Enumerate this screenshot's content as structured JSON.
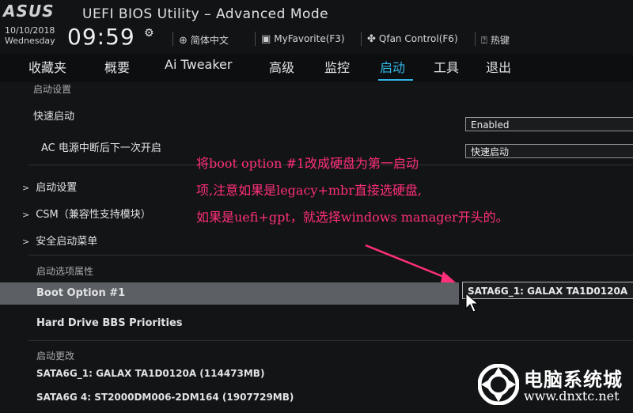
{
  "header": {
    "logo": "ASUS",
    "title": "UEFI BIOS Utility – Advanced Mode",
    "date": "10/10/2018",
    "weekday": "Wednesday",
    "time": "09:59",
    "items": [
      {
        "label": "简体中文",
        "icon": "globe-icon"
      },
      {
        "label": "MyFavorite(F3)",
        "icon": "favorite-icon"
      },
      {
        "label": "Qfan Control(F6)",
        "icon": "fan-icon"
      },
      {
        "label": "热键",
        "icon": "help-icon"
      }
    ]
  },
  "nav": {
    "tabs": [
      "收藏夹",
      "概要",
      "Ai Tweaker",
      "高级",
      "监控",
      "启动",
      "工具",
      "退出"
    ],
    "active": "启动"
  },
  "main": {
    "breadcrumb": "启动设置",
    "fast_boot": "快速启动",
    "ac_power": "AC 电源中断后下一次开启",
    "fast_boot_value": "Enabled",
    "ac_power_value": "快速启动",
    "submenus": [
      "启动设置",
      "CSM（兼容性支持模块）",
      "安全启动菜单"
    ],
    "boot_section": "启动选项属性",
    "boot_option_label": "Boot Option #1",
    "boot_option_value": "SATA6G_1: GALAX TA1D0120A",
    "hdd_bbs": "Hard Drive BBS Priorities",
    "boot_override_section": "启动更改",
    "devices": [
      "SATA6G_1: GALAX TA1D0120A  (114473MB)",
      "SATA6G 4: ST2000DM006-2DM164  (1907729MB)"
    ]
  },
  "annotation": {
    "lines": [
      "将boot option #1改成硬盘为第一启动",
      "项,注意如果是legacy+mbr直接选硬盘,",
      "如果是uefi+gpt，就选择windows manager开头的。"
    ],
    "color": "#ff2f7a"
  },
  "watermark": {
    "name": "电脑系统城",
    "url": "www.dnxtc.net"
  },
  "colors": {
    "accent": "#33b6e6",
    "highlight_row": "#5c6064"
  }
}
